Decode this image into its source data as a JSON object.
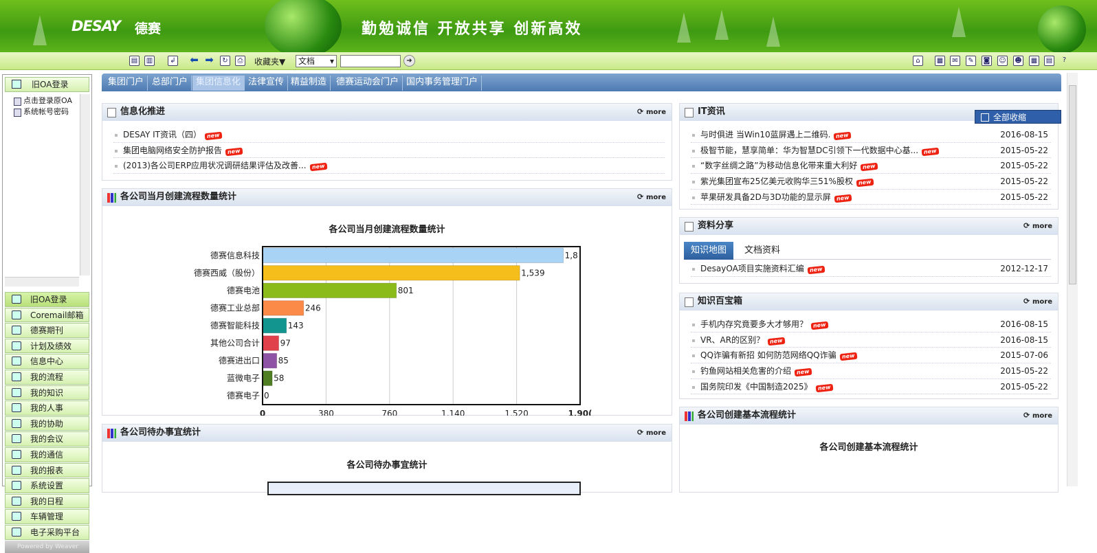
{
  "banner": {
    "logo": "DESAY",
    "logo_cn": "德赛",
    "slogan": "勤勉诚信 开放共享 创新高效"
  },
  "toolbar": {
    "favorites": "收藏夹▼",
    "doc_select": "文档",
    "search_placeholder": ""
  },
  "left_tree": {
    "header": "旧OA登录",
    "items": [
      "点击登录原OA",
      "系统帐号密码"
    ]
  },
  "left_menu": [
    {
      "label": "旧OA登录",
      "icon": "doc-icon"
    },
    {
      "label": "Coremail邮箱",
      "icon": "mail-icon"
    },
    {
      "label": "德赛期刊",
      "icon": "book-icon"
    },
    {
      "label": "计划及绩效",
      "icon": "plan-icon"
    },
    {
      "label": "信息中心",
      "icon": "info-icon"
    },
    {
      "label": "我的流程",
      "icon": "flow-icon"
    },
    {
      "label": "我的知识",
      "icon": "knowledge-icon"
    },
    {
      "label": "我的人事",
      "icon": "person-icon"
    },
    {
      "label": "我的协助",
      "icon": "users-icon"
    },
    {
      "label": "我的会议",
      "icon": "meeting-icon"
    },
    {
      "label": "我的通信",
      "icon": "envelope-icon"
    },
    {
      "label": "我的报表",
      "icon": "report-icon"
    },
    {
      "label": "系统设置",
      "icon": "gear-icon"
    },
    {
      "label": "我的日程",
      "icon": "calendar-icon"
    },
    {
      "label": "车辆管理",
      "icon": "car-icon"
    },
    {
      "label": "电子采购平台",
      "icon": "cart-icon"
    }
  ],
  "powered": "Powered by Weaver",
  "tabs": [
    "集团门户",
    "总部门户",
    "集团信息化",
    "法律宣传",
    "精益制造",
    "德赛运动会门户",
    "国内事务管理门户"
  ],
  "active_tab": 2,
  "new_badge": "new",
  "more_label": "more",
  "collapse_all": "全部收缩",
  "info_push": {
    "title": "信息化推进",
    "items": [
      "DESAY IT资讯（四）",
      "集团电脑网络安全防护报告",
      "(2013)各公司ERP应用状况调研结果评估及改善..."
    ]
  },
  "it_news": {
    "title": "IT资讯",
    "items": [
      {
        "text": "与时俱进 当Win10蓝屏遇上二维码.",
        "date": "2016-08-15"
      },
      {
        "text": "极智节能，慧享简单：华为智慧DC引领下一代数据中心基...",
        "date": "2015-05-22"
      },
      {
        "text": "“数字丝绸之路”为移动信息化带来重大利好",
        "date": "2015-05-22"
      },
      {
        "text": "紫光集团宣布25亿美元收购华三51%股权",
        "date": "2015-05-22"
      },
      {
        "text": "苹果研发具备2D与3D功能的显示屏",
        "date": "2015-05-22"
      }
    ]
  },
  "resources": {
    "title": "资料分享",
    "tabs": [
      "知识地图",
      "文档资料"
    ],
    "items": [
      {
        "text": "DesayOA项目实施资料汇编",
        "date": "2012-12-17"
      }
    ]
  },
  "knowledge": {
    "title": "知识百宝箱",
    "items": [
      {
        "text": "手机内存究竟要多大才够用？",
        "date": "2016-08-15"
      },
      {
        "text": "VR、AR的区别？",
        "date": "2016-08-15"
      },
      {
        "text": "QQ诈骗有新招 如何防范网络QQ诈骗",
        "date": "2015-07-06"
      },
      {
        "text": "钓鱼网站相关危害的介绍",
        "date": "2015-05-22"
      },
      {
        "text": "国务院印发《中国制造2025》",
        "date": "2015-05-22"
      }
    ]
  },
  "flow_stats_portlet": {
    "title": "各公司当月创建流程数量统计"
  },
  "pending_portlet": {
    "title": "各公司待办事宜统计",
    "chart_title": "各公司待办事宜统计"
  },
  "basic_flow_portlet": {
    "title": "各公司创建基本流程统计",
    "chart_title": "各公司创建基本流程统计"
  },
  "chart_data": {
    "type": "bar",
    "orientation": "horizontal",
    "title": "各公司当月创建流程数量统计",
    "categories": [
      "德赛信息科技",
      "德赛西威（股份）",
      "德赛电池",
      "德赛工业总部",
      "德赛智能科技",
      "其他公司合计",
      "德赛进出口",
      "蓝微电子",
      "德赛电子"
    ],
    "values": [
      1800,
      1539,
      801,
      246,
      143,
      97,
      85,
      58,
      0
    ],
    "value_labels": [
      "1,8",
      "1,539",
      "801",
      "246",
      "143",
      "97",
      "85",
      "58",
      "0"
    ],
    "colors": [
      "#a9d3f5",
      "#f6be1a",
      "#8bbb1b",
      "#fb8a49",
      "#12948f",
      "#e0404a",
      "#8e53a4",
      "#4f7d22",
      "#888888"
    ],
    "xlim": [
      0,
      1900
    ],
    "xticks": [
      "0",
      "380",
      "760",
      "1,140",
      "1,520",
      "1,90("
    ],
    "grid": true
  }
}
